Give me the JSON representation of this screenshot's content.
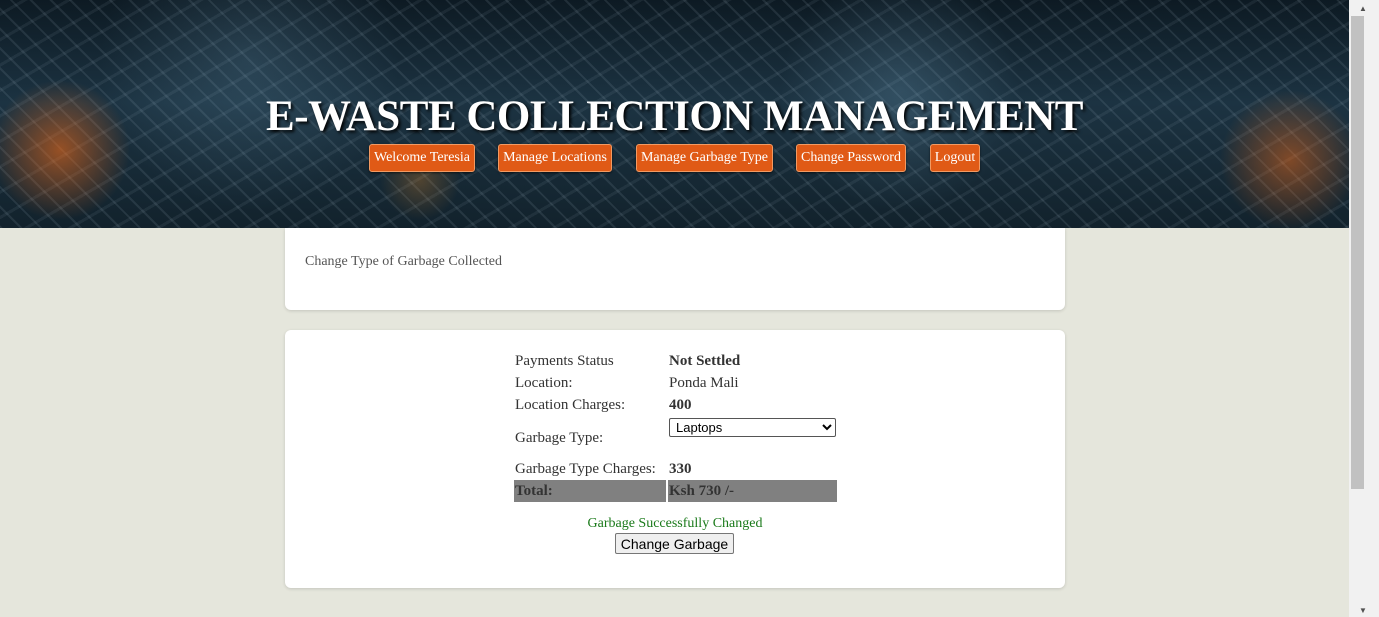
{
  "header": {
    "title": "E-WASTE COLLECTION MANAGEMENT",
    "nav": [
      {
        "label": "Welcome Teresia"
      },
      {
        "label": "Manage Locations"
      },
      {
        "label": "Manage Garbage Type"
      },
      {
        "label": "Change Password"
      },
      {
        "label": "Logout"
      }
    ]
  },
  "intro": {
    "subtitle": "Change Type of Garbage Collected"
  },
  "details": {
    "payment_status_label": "Payments Status",
    "payment_status_value": "Not Settled",
    "location_label": "Location:",
    "location_value": "Ponda Mali",
    "location_charges_label": "Location Charges:",
    "location_charges_value": "400",
    "garbage_type_label": "Garbage Type:",
    "garbage_type_selected": "Laptops",
    "garbage_type_charges_label": "Garbage Type Charges:",
    "garbage_type_charges_value": "330",
    "total_label": "Total:",
    "total_value": "Ksh 730 /-"
  },
  "status_message": "Garbage Successfully Changed",
  "change_button_label": "Change Garbage",
  "colors": {
    "nav_button": "#e05a16",
    "background": "#e5e6dc",
    "success": "#1a7a1a",
    "total_row": "#808080"
  }
}
